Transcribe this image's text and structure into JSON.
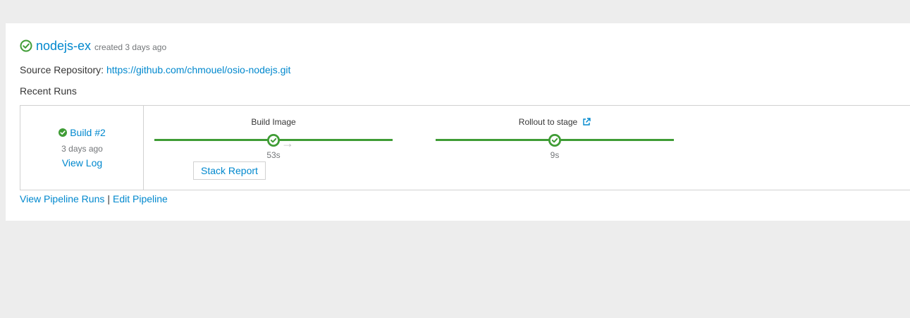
{
  "pipeline": {
    "name": "nodejs-ex",
    "created": "created 3 days ago",
    "source_label": "Source Repository:",
    "source_url": "https://github.com/chmouel/osio-nodejs.git",
    "recent_runs_label": "Recent Runs",
    "status_icon": "check-circle-icon"
  },
  "run": {
    "build_label": "Build #2",
    "time": "3 days ago",
    "view_log_label": "View Log",
    "status_icon": "check-circle-icon"
  },
  "stages": [
    {
      "name": "Build Image",
      "duration": "53s",
      "status": "complete",
      "action_label": "Stack Report"
    },
    {
      "name": "Rollout to stage",
      "duration": "9s",
      "status": "complete",
      "icon": "external-link-icon"
    }
  ],
  "footer": {
    "view_runs_label": "View Pipeline Runs",
    "separator": "|",
    "edit_label": "Edit Pipeline"
  },
  "colors": {
    "link": "#0088ce",
    "success": "#3f9c35",
    "page_bg": "#ededed"
  }
}
